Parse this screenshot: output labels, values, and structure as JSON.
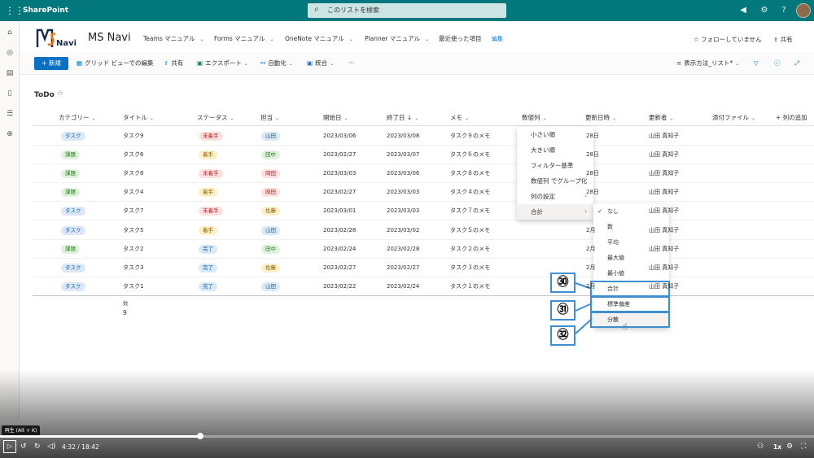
{
  "suite": {
    "brand": "SharePoint",
    "search_placeholder": "このリストを検索"
  },
  "site": {
    "logo_text": "MSNavi",
    "name": "MS Navi",
    "nav": [
      "Teams マニュアル",
      "Forms マニュアル",
      "OneNote マニュアル",
      "Planner マニュアル",
      "最近使った項目"
    ],
    "edit": "編集",
    "follow": "フォローしていません",
    "share": "共有"
  },
  "commands": {
    "new": "+ 新規",
    "grid_edit": "グリッド ビューでの編集",
    "share": "共有",
    "export": "エクスポート",
    "automate": "自動化",
    "integrate": "統合",
    "more": "···",
    "view_options": "表示方法_リスト*"
  },
  "list": {
    "title": "ToDo",
    "columns": [
      "カテゴリー",
      "タイトル",
      "ステータス",
      "担当",
      "開始日",
      "終了日 ↓",
      "メモ",
      "数値列",
      "更新日時",
      "更新者",
      "添付ファイル",
      "+ 列の追加"
    ],
    "rows": [
      {
        "category": "タスク",
        "title": "タスク9",
        "status": "未着手",
        "owner": "山田",
        "start": "2023/03/06",
        "end": "2023/03/08",
        "memo": "タスク９のメモ",
        "modified": "28日",
        "editor": "山田 真知子"
      },
      {
        "category": "課題",
        "title": "タスク6",
        "status": "着手",
        "owner": "田中",
        "start": "2023/02/27",
        "end": "2023/03/07",
        "memo": "タスク６のメモ",
        "modified": "28日",
        "editor": "山田 真知子"
      },
      {
        "category": "課題",
        "title": "タスク8",
        "status": "未着手",
        "owner": "岡田",
        "start": "2023/03/03",
        "end": "2023/03/06",
        "memo": "タスク８のメモ",
        "modified": "28日",
        "editor": "山田 真知子"
      },
      {
        "category": "課題",
        "title": "タスク4",
        "status": "着手",
        "owner": "岡田",
        "start": "2023/02/27",
        "end": "2023/03/03",
        "memo": "タスク４のメモ",
        "modified": "28日",
        "editor": "山田 真知子"
      },
      {
        "category": "タスク",
        "title": "タスク7",
        "status": "未着手",
        "owner": "佐藤",
        "start": "2023/03/01",
        "end": "2023/03/03",
        "memo": "タスク７のメモ",
        "modified": "",
        "editor": "山田 真知子"
      },
      {
        "category": "タスク",
        "title": "タスク5",
        "status": "着手",
        "owner": "山田",
        "start": "2023/02/28",
        "end": "2023/03/02",
        "memo": "タスク５のメモ",
        "modified": "2月",
        "editor": "山田 真知子"
      },
      {
        "category": "課題",
        "title": "タスク2",
        "status": "完了",
        "owner": "田中",
        "start": "2023/02/24",
        "end": "2023/02/28",
        "memo": "タスク２のメモ",
        "modified": "2月",
        "editor": "山田 真知子"
      },
      {
        "category": "タスク",
        "title": "タスク3",
        "status": "完了",
        "owner": "佐藤",
        "start": "2023/02/27",
        "end": "2023/02/27",
        "memo": "タスク３のメモ",
        "modified": "2月",
        "editor": "山田 真知子"
      },
      {
        "category": "タスク",
        "title": "タスク1",
        "status": "完了",
        "owner": "山田",
        "start": "2023/02/22",
        "end": "2023/02/24",
        "memo": "タスク１のメモ",
        "modified": "2月",
        "editor": "山田 真知子"
      }
    ],
    "footer_label": "数",
    "footer_value": "9"
  },
  "column_menu": [
    "小さい順",
    "大きい順",
    "フィルター基準",
    "数値列 でグループ化",
    "列の設定",
    "合計"
  ],
  "totals_menu": [
    "なし",
    "数",
    "平均",
    "最大値",
    "最小値",
    "合計",
    "標準偏差",
    "分散"
  ],
  "callouts": [
    "㉚",
    "㉛",
    "㉜"
  ],
  "video": {
    "tooltip": "再生 (Alt + K)",
    "time": "4:32 / 18:42",
    "progress": 0.246,
    "speed": "1x"
  },
  "colors": {
    "suite": "#03787c",
    "accent": "#0b6fc4",
    "cat_task_bg": "#dce8f8",
    "cat_task_fg": "#0f5fa8",
    "cat_issue_bg": "#dff3dc",
    "cat_issue_fg": "#2b7a1f",
    "st_todo_bg": "#fde0e0",
    "st_todo_fg": "#b52020",
    "st_doing_bg": "#fdf0c8",
    "st_doing_fg": "#8a5a00",
    "st_done_bg": "#dbe9f7",
    "st_done_fg": "#0f5fa8",
    "owner_yamada_bg": "#dbe9f7",
    "owner_yamada_fg": "#0f5fa8",
    "owner_tanaka_bg": "#dff3dc",
    "owner_tanaka_fg": "#2b7a1f",
    "owner_okada_bg": "#fde0e0",
    "owner_okada_fg": "#b52020",
    "owner_sato_bg": "#fdf0c8",
    "owner_sato_fg": "#8a5a00"
  }
}
